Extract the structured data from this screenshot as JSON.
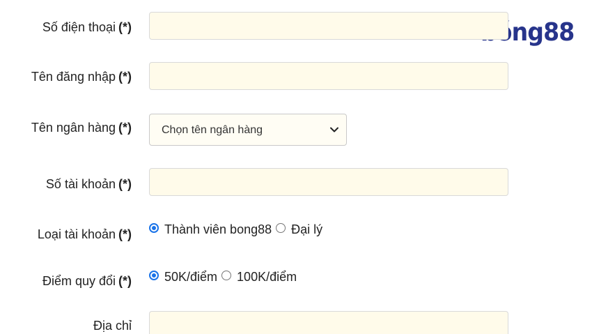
{
  "brand": {
    "logo_text": "bóng88",
    "color": "#27348b"
  },
  "colors": {
    "input_bg": "#fffbea",
    "radio_accent": "#1a73e8"
  },
  "form": {
    "required_mark": "(*)",
    "phone": {
      "label": "Số điện thoại",
      "value": ""
    },
    "username": {
      "label": "Tên đăng nhập",
      "value": ""
    },
    "bank": {
      "label": "Tên ngân hàng",
      "selected": "Chọn tên ngân hàng",
      "icon": "chevron-down-icon"
    },
    "account_number": {
      "label": "Số tài khoản",
      "value": ""
    },
    "account_type": {
      "label": "Loại tài khoản",
      "options": [
        {
          "label": "Thành viên bong88",
          "checked": true
        },
        {
          "label": "Đại lý",
          "checked": false
        }
      ]
    },
    "conversion": {
      "label": "Điểm quy đổi",
      "options": [
        {
          "label": "50K/điểm",
          "checked": true
        },
        {
          "label": "100K/điểm",
          "checked": false
        }
      ]
    },
    "address": {
      "label": "Địa chỉ",
      "value": ""
    }
  }
}
